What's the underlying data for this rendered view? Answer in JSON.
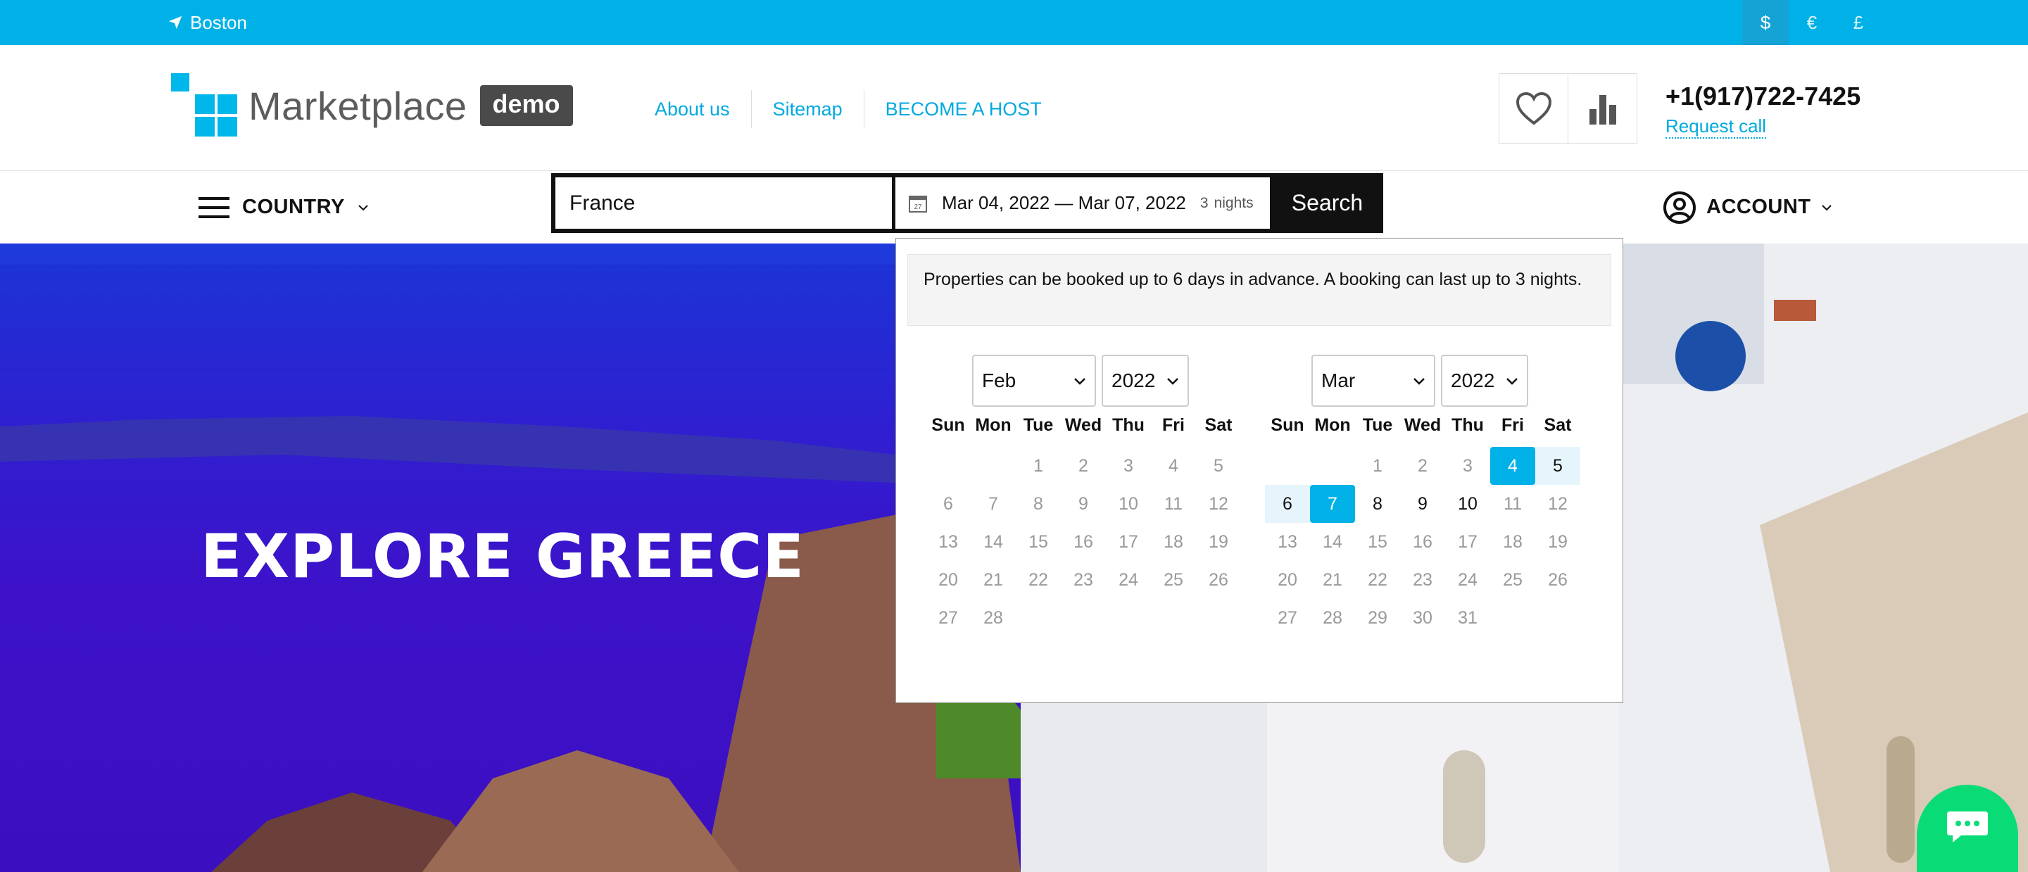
{
  "topbar": {
    "location": "Boston",
    "currencies": [
      {
        "symbol": "$",
        "active": true
      },
      {
        "symbol": "€",
        "active": false
      },
      {
        "symbol": "£",
        "active": false
      }
    ]
  },
  "header": {
    "logo_text": "Marketplace",
    "logo_badge": "demo",
    "nav": [
      "About us",
      "Sitemap",
      "BECOME A HOST"
    ],
    "phone": "+1(917)722-7425",
    "request_call": "Request call"
  },
  "subbar": {
    "country_label": "COUNTRY",
    "account_label": "ACCOUNT"
  },
  "search": {
    "destination": "France",
    "dates": "Mar 04, 2022 — Mar 07, 2022",
    "calendar_icon_day": "27",
    "nights_count": "3",
    "nights_label": "nights",
    "button": "Search"
  },
  "hero": {
    "title": "EXPLORE GREECE"
  },
  "datepicker": {
    "notice": "Properties can be booked up to 6 days in advance. A booking can last up to 3 nights.",
    "weekdays": [
      "Sun",
      "Mon",
      "Tue",
      "Wed",
      "Thu",
      "Fri",
      "Sat"
    ],
    "months": [
      {
        "month": "Feb",
        "year": "2022",
        "first_weekday": 2,
        "days": 28,
        "available": [],
        "range": [],
        "selected": []
      },
      {
        "month": "Mar",
        "year": "2022",
        "first_weekday": 2,
        "days": 31,
        "available": [
          4,
          5,
          6,
          7,
          8,
          9,
          10
        ],
        "range": [
          5,
          6
        ],
        "selected": [
          4,
          7
        ]
      }
    ]
  },
  "colors": {
    "brand": "#00b1e7",
    "chat": "#09dc76"
  }
}
